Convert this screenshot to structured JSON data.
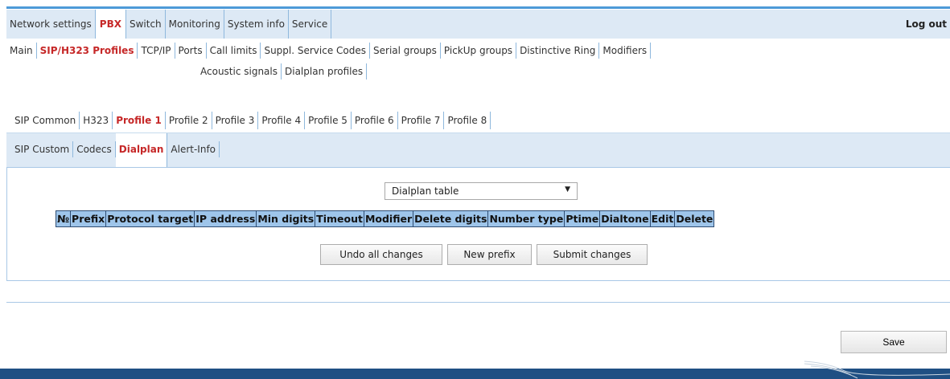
{
  "main_nav": {
    "tabs": [
      "Network settings",
      "PBX",
      "Switch",
      "Monitoring",
      "System info",
      "Service"
    ],
    "active": "PBX",
    "logout_label": "Log out"
  },
  "sub_nav": {
    "row1": [
      "Main",
      "SIP/H323 Profiles",
      "TCP/IP",
      "Ports",
      "Call limits",
      "Suppl. Service Codes",
      "Serial groups",
      "PickUp groups",
      "Distinctive Ring",
      "Modifiers"
    ],
    "row2": [
      "Acoustic signals",
      "Dialplan profiles"
    ],
    "active": "SIP/H323 Profiles"
  },
  "profile_tabs": {
    "tabs": [
      "SIP Common",
      "H323",
      "Profile 1",
      "Profile 2",
      "Profile 3",
      "Profile 4",
      "Profile 5",
      "Profile 6",
      "Profile 7",
      "Profile 8"
    ],
    "active": "Profile 1"
  },
  "inner_tabs": {
    "tabs": [
      "SIP Custom",
      "Codecs",
      "Dialplan",
      "Alert-Info"
    ],
    "active": "Dialplan"
  },
  "dialplan": {
    "select_value": "Dialplan table",
    "columns": [
      "№",
      "Prefix",
      "Protocol target",
      "IP address",
      "Min digits",
      "Timeout",
      "Modifier",
      "Delete digits",
      "Number type",
      "Ptime",
      "Dialtone",
      "Edit",
      "Delete"
    ],
    "buttons": {
      "undo": "Undo all changes",
      "new_prefix": "New prefix",
      "submit": "Submit changes"
    }
  },
  "save_label": "Save",
  "colors": {
    "accent_line": "#4d9ad8",
    "nav_background": "#dde9f5",
    "active_tab_text": "#c62828",
    "table_header_bg": "#9ec5ea",
    "footer_bar": "#1f4f83"
  }
}
